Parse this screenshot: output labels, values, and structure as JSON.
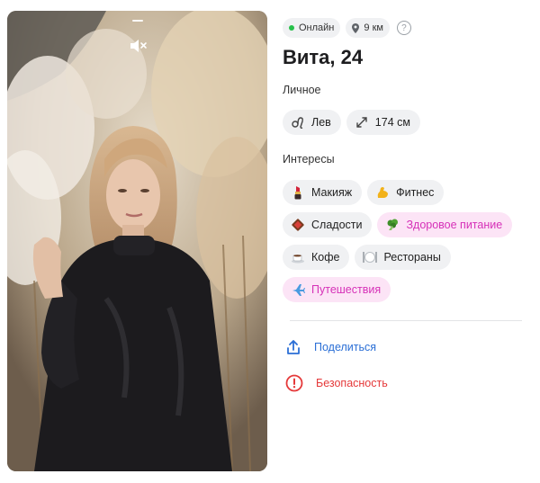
{
  "status": {
    "online_label": "Онлайн",
    "distance_label": "9 км",
    "help_symbol": "?",
    "online_color": "#27c04a"
  },
  "profile": {
    "name_age": "Вита, 24"
  },
  "personal": {
    "label": "Личное",
    "items": [
      {
        "icon": "leo-zodiac-icon",
        "text": "Лев"
      },
      {
        "icon": "height-arrows-icon",
        "text": "174 см"
      }
    ]
  },
  "interests": {
    "label": "Интересы",
    "items": [
      {
        "icon": "lipstick-icon",
        "text": "Макияж",
        "highlighted": false
      },
      {
        "icon": "flexed-biceps-icon",
        "text": "Фитнес",
        "highlighted": false
      },
      {
        "icon": "chocolate-icon",
        "text": "Сладости",
        "highlighted": false
      },
      {
        "icon": "broccoli-icon",
        "text": "Здоровое питание",
        "highlighted": true
      },
      {
        "icon": "coffee-cup-icon",
        "text": "Кофе",
        "highlighted": false
      },
      {
        "icon": "fork-knife-plate-icon",
        "text": "Рестораны",
        "highlighted": false
      },
      {
        "icon": "airplane-icon",
        "text": "Путешествия",
        "highlighted": true
      }
    ]
  },
  "actions": {
    "share_label": "Поделиться",
    "safety_label": "Безопасность",
    "share_color": "#2b6fd6",
    "safety_color": "#e5393a"
  },
  "colors": {
    "chip_bg": "#f0f1f3",
    "highlight_bg": "#fce4f6",
    "highlight_text": "#d631b8"
  }
}
